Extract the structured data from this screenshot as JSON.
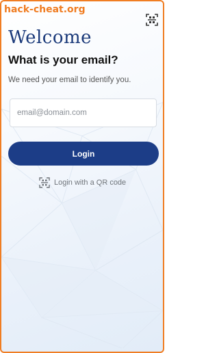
{
  "watermark": "hack-cheat.org",
  "header": {
    "title": "Welcome",
    "subtitle": "What is your email?"
  },
  "hint": "We need your email to identify you.",
  "email_field": {
    "placeholder": "email@domain.com",
    "value": ""
  },
  "login_button": {
    "label": "Login"
  },
  "qr_login": {
    "label": "Login with a QR code"
  },
  "icons": {
    "top_right": "qr-scan-icon",
    "qr_login": "qr-scan-icon"
  },
  "colors": {
    "brand": "#1c3d87",
    "border": "#f07d22",
    "title": "#1b3a7a"
  }
}
